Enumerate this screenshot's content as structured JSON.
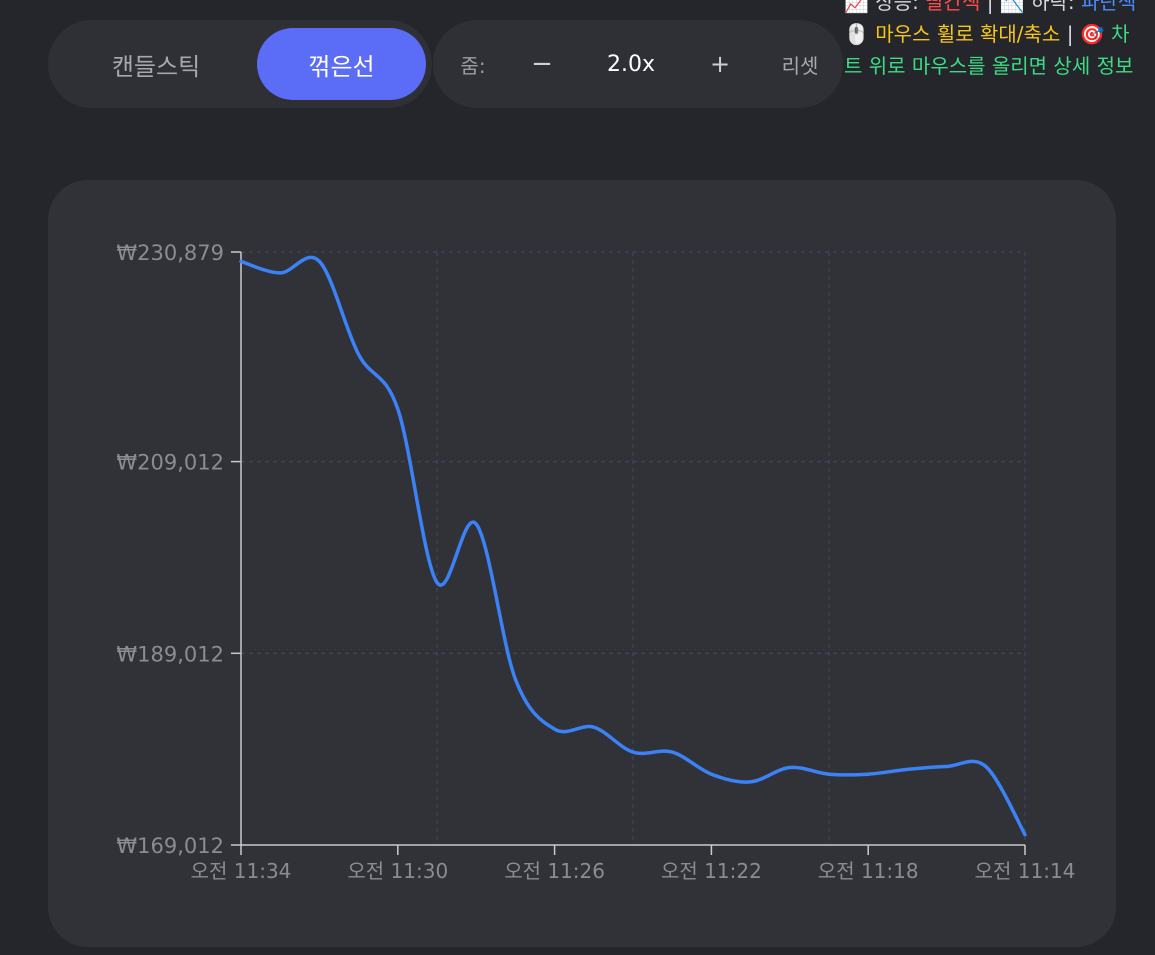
{
  "chart_type_toggle": {
    "candlestick_label": "캔들스틱",
    "line_label": "꺾은선",
    "selected": "line"
  },
  "zoom": {
    "label": "줌:",
    "minus_label": "−",
    "value": "2.0x",
    "plus_label": "+",
    "reset_label": "리셋"
  },
  "help": {
    "up_emoji": "📈",
    "up_text": "상승:",
    "up_color_word": "빨간색",
    "down_emoji": "📉",
    "down_text": "하락:",
    "down_color_word": "파란색",
    "mouse_emoji": "🖱️",
    "mouse_text": "마우스 휠로 확대/축소",
    "separator": "|",
    "target_emoji": "🎯",
    "hover_text": "차트 위로 마우스를 올리면 상세 정보",
    "colors": {
      "up": "#ff4d4d",
      "down": "#4a8cff",
      "mouse": "#f5c518",
      "hover": "#3ddc84"
    }
  },
  "colors": {
    "page_background": "#25262b",
    "card_background": "#313238",
    "accent": "#5b6cf6",
    "line": "#3b82f6",
    "grid": "#3d4a66",
    "axis": "#c9cacf",
    "tick_label": "#8b8c92"
  },
  "chart_data": {
    "type": "line",
    "x_order": "descending time",
    "xlim": [
      "오전 11:34",
      "오전 11:14"
    ],
    "x_minutes": [
      34,
      33,
      32,
      31,
      30,
      29,
      28,
      27,
      26,
      25,
      24,
      23,
      22,
      21,
      20,
      19,
      18,
      17,
      16,
      15,
      14
    ],
    "x_tick_labels": [
      "오전 11:34",
      "오전 11:30",
      "오전 11:26",
      "오전 11:22",
      "오전 11:18",
      "오전 11:14"
    ],
    "x_tick_minutes": [
      34,
      30,
      26,
      22,
      18,
      14
    ],
    "grid_minutes": [
      29,
      24,
      19
    ],
    "y_tick_values": [
      169012,
      189012,
      209012,
      230879
    ],
    "y_tick_labels": [
      "₩169,012",
      "₩189,012",
      "₩209,012",
      "₩230,879"
    ],
    "ylim": [
      169012,
      230879
    ],
    "grid": true,
    "series": [
      {
        "values": [
          229900,
          228700,
          229900,
          220200,
          214500,
          196400,
          202500,
          186300,
          181100,
          181300,
          178700,
          178700,
          176400,
          175600,
          177100,
          176400,
          176400,
          176900,
          177200,
          177200,
          170100
        ]
      }
    ]
  }
}
